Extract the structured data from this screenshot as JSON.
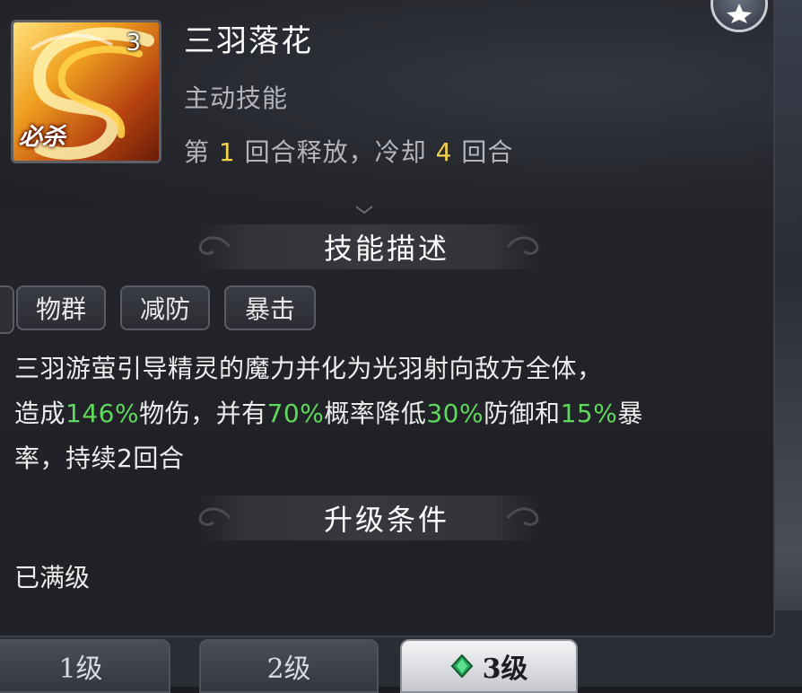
{
  "skill": {
    "name": "三羽落花",
    "type": "主动技能",
    "level_badge": "3",
    "kill_label": "必杀",
    "cooldown": {
      "prefix": "第",
      "release_round": "1",
      "middle": "回合释放，冷却",
      "cooldown_rounds": "4",
      "suffix": "回合"
    }
  },
  "description_section": {
    "title": "技能描述",
    "tags": [
      "物群",
      "减防",
      "暴击"
    ],
    "text": {
      "line1": "三羽游萤引导精灵的魔力并化为光羽射向敌方全体，",
      "p1": "造成",
      "v1": "146%",
      "p2": "物伤，并有",
      "v2": "70%",
      "p3": "概率降低",
      "v3": "30%",
      "p4": "防御和",
      "v4": "15%",
      "p5": "暴",
      "line3": "率，持续2回合"
    }
  },
  "upgrade_section": {
    "title": "升级条件",
    "text": "已满级"
  },
  "level_tabs": [
    {
      "label": "1级",
      "active": false
    },
    {
      "label": "2级",
      "active": false
    },
    {
      "label": "3级",
      "active": true
    }
  ],
  "colors": {
    "highlight_green": "#5fd85c",
    "highlight_yellow": "#f2d24a",
    "panel_bg": "#1f2126"
  },
  "icons": {
    "corner": "star-icon",
    "active_tab": "gem-icon"
  }
}
